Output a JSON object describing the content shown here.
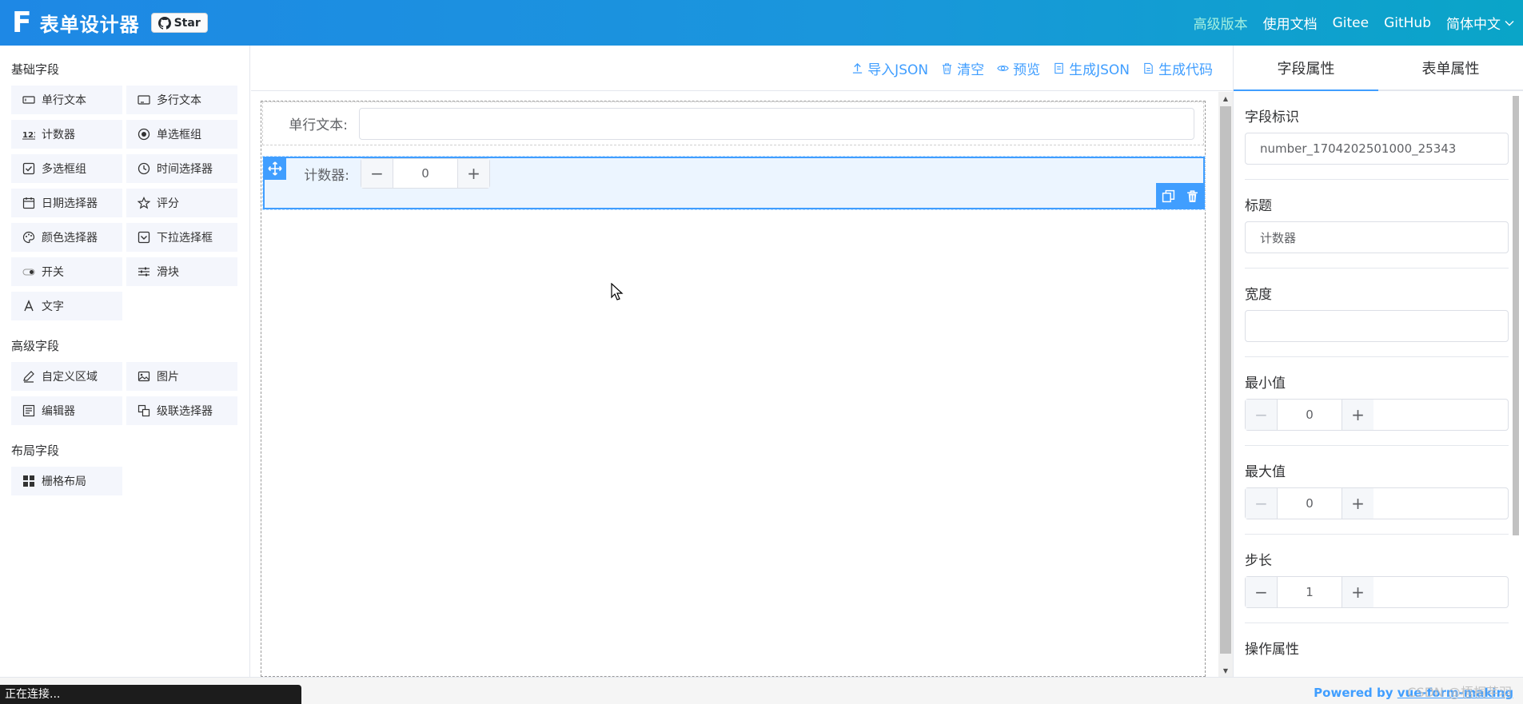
{
  "header": {
    "logo_letter": "F",
    "title": "表单设计器",
    "star_label": "Star",
    "nav": [
      {
        "label": "高级版本"
      },
      {
        "label": "使用文档"
      },
      {
        "label": "Gitee"
      },
      {
        "label": "GitHub"
      },
      {
        "label": "简体中文"
      }
    ]
  },
  "left": {
    "basic_title": "基础字段",
    "basic": [
      {
        "label": "单行文本",
        "icon": "input-icon"
      },
      {
        "label": "多行文本",
        "icon": "textarea-icon"
      },
      {
        "label": "计数器",
        "icon": "number-icon"
      },
      {
        "label": "单选框组",
        "icon": "radio-icon"
      },
      {
        "label": "多选框组",
        "icon": "checkbox-icon"
      },
      {
        "label": "时间选择器",
        "icon": "clock-icon"
      },
      {
        "label": "日期选择器",
        "icon": "calendar-icon"
      },
      {
        "label": "评分",
        "icon": "star-icon"
      },
      {
        "label": "颜色选择器",
        "icon": "palette-icon"
      },
      {
        "label": "下拉选择框",
        "icon": "select-icon"
      },
      {
        "label": "开关",
        "icon": "switch-icon"
      },
      {
        "label": "滑块",
        "icon": "slider-icon"
      },
      {
        "label": "文字",
        "icon": "text-icon"
      }
    ],
    "advanced_title": "高级字段",
    "advanced": [
      {
        "label": "自定义区域",
        "icon": "pen-icon"
      },
      {
        "label": "图片",
        "icon": "image-icon"
      },
      {
        "label": "编辑器",
        "icon": "editor-icon"
      },
      {
        "label": "级联选择器",
        "icon": "cascader-icon"
      }
    ],
    "layout_title": "布局字段",
    "layout": [
      {
        "label": "栅格布局",
        "icon": "grid-icon"
      }
    ]
  },
  "toolbar": {
    "import_json": "导入JSON",
    "clear": "清空",
    "preview": "预览",
    "gen_json": "生成JSON",
    "gen_code": "生成代码"
  },
  "canvas": {
    "text_label": "单行文本:",
    "number_label": "计数器:",
    "number_value": "0"
  },
  "right": {
    "tab_field": "字段属性",
    "tab_form": "表单属性",
    "model_label": "字段标识",
    "model_value": "number_1704202501000_25343",
    "title_label": "标题",
    "title_value": "计数器",
    "width_label": "宽度",
    "width_value": "",
    "min_label": "最小值",
    "min_value": "0",
    "max_label": "最大值",
    "max_value": "0",
    "step_label": "步长",
    "step_value": "1",
    "ops_label": "操作属性"
  },
  "footer": {
    "powered_prefix": "Powered by ",
    "powered_link": "vue-form-making",
    "watermark": "CSDN @梧桐芊羽",
    "status": "正在连接..."
  },
  "colors": {
    "primary": "#409eff",
    "header_start": "#1e88e5",
    "header_end": "#0aa5c8"
  }
}
